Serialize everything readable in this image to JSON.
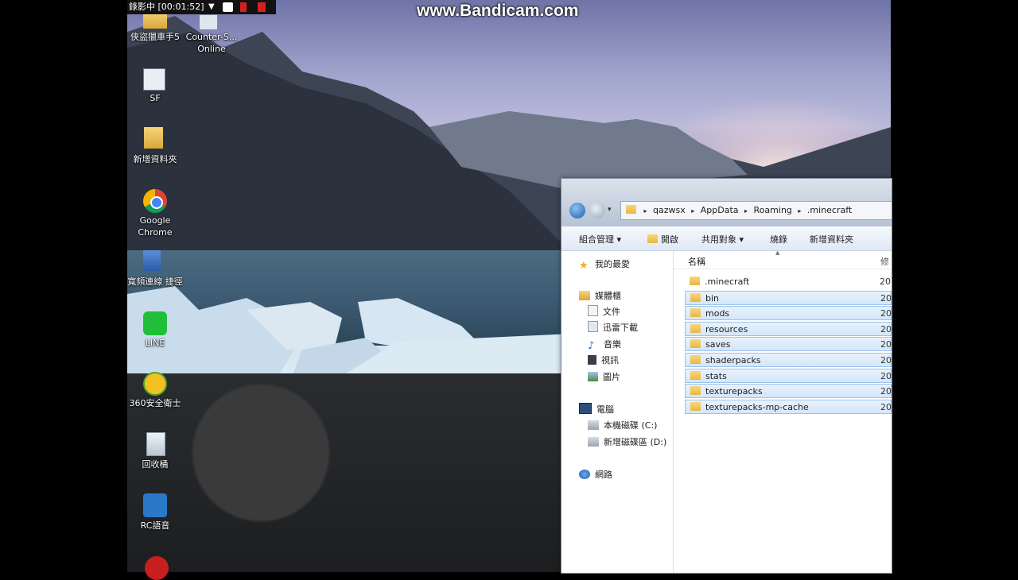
{
  "recorder": {
    "status": "錄影中 [00:01:52]"
  },
  "watermark": "www.Bandicam.com",
  "desktop": {
    "icons": [
      {
        "label": "俠盜獵車手5"
      },
      {
        "label": "Counter-S... Online"
      },
      {
        "label": "SF"
      },
      {
        "label": "新增資料夾"
      },
      {
        "label": "Google Chrome"
      },
      {
        "label": "寬頻連線 捷徑"
      },
      {
        "label": "LINE"
      },
      {
        "label": "360安全衛士"
      },
      {
        "label": "回收桶"
      },
      {
        "label": "RC語音"
      }
    ]
  },
  "explorer": {
    "address": [
      "qazwsx",
      "AppData",
      "Roaming",
      ".minecraft"
    ],
    "toolbar": {
      "organize": "組合管理 ▾",
      "open": "開啟",
      "share": "共用對象 ▾",
      "burn": "燒錄",
      "new_folder": "新增資料夾"
    },
    "nav": {
      "favorites": "我的最愛",
      "libraries": "媒體櫃",
      "lib_items": [
        "文件",
        "迅雷下載",
        "音樂",
        "視訊",
        "圖片"
      ],
      "computer": "電腦",
      "drives": [
        "本機磁碟 (C:)",
        "新增磁碟區 (D:)"
      ],
      "network": "網路"
    },
    "columns": {
      "name": "名稱",
      "modified": "修"
    },
    "files": [
      {
        "name": ".minecraft",
        "date": "20",
        "selected": false
      },
      {
        "name": "bin",
        "date": "20",
        "selected": true
      },
      {
        "name": "mods",
        "date": "20",
        "selected": true
      },
      {
        "name": "resources",
        "date": "20",
        "selected": true
      },
      {
        "name": "saves",
        "date": "20",
        "selected": true
      },
      {
        "name": "shaderpacks",
        "date": "20",
        "selected": true
      },
      {
        "name": "stats",
        "date": "20",
        "selected": true
      },
      {
        "name": "texturepacks",
        "date": "20",
        "selected": true
      },
      {
        "name": "texturepacks-mp-cache",
        "date": "20",
        "selected": true
      }
    ]
  }
}
